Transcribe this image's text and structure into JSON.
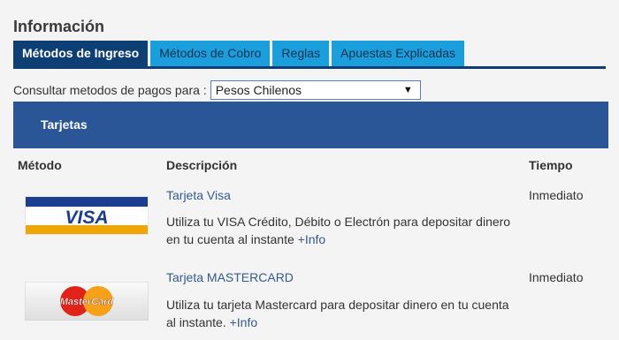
{
  "header": {
    "title": "Información"
  },
  "tabs": [
    {
      "label": "Métodos de Ingreso",
      "active": true
    },
    {
      "label": "Métodos de Cobro",
      "active": false
    },
    {
      "label": "Reglas",
      "active": false
    },
    {
      "label": "Apuestas Explicadas",
      "active": false
    }
  ],
  "filter": {
    "label": "Consultar metodos de pagos para :",
    "selected": "Pesos Chilenos"
  },
  "section": {
    "title": "Tarjetas"
  },
  "table": {
    "headers": {
      "method": "Método",
      "description": "Descripción",
      "time": "Tiempo"
    },
    "rows": [
      {
        "logo_text": "VISA",
        "name": "Tarjeta Visa",
        "desc": "Utiliza tu VISA Crédito, Débito o Electrón para depositar dinero en tu cuenta al instante",
        "more": "+Info",
        "time": "Inmediato"
      },
      {
        "logo_text": "MasterCard",
        "name": "Tarjeta MASTERCARD",
        "desc": "Utiliza tu tarjeta Mastercard para depositar dinero en tu cuenta al instante.",
        "more": "+Info",
        "time": "Inmediato"
      }
    ]
  },
  "colors": {
    "active_tab": "#0e3f74",
    "tab": "#1a9fdc",
    "section_bar": "#2a5597",
    "link": "#335b94"
  }
}
